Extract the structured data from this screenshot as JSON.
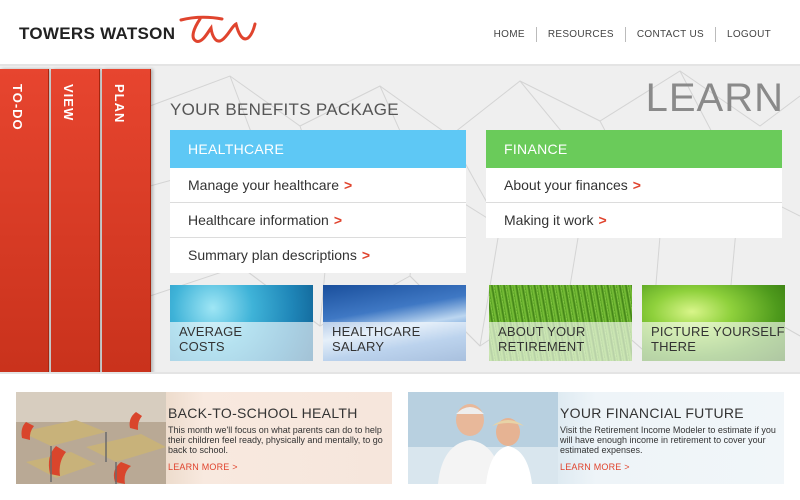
{
  "header": {
    "logo_text": "TOWERS WATSON",
    "nav": [
      {
        "label": "HOME"
      },
      {
        "label": "RESOURCES"
      },
      {
        "label": "CONTACT US"
      },
      {
        "label": "LOGOUT"
      }
    ]
  },
  "side_tabs": [
    {
      "label": "TO-DO"
    },
    {
      "label": "VIEW"
    },
    {
      "label": "PLAN"
    }
  ],
  "main": {
    "section_title": "LEARN",
    "package_title": "YOUR BENEFITS PACKAGE",
    "healthcare": {
      "title": "HEALTHCARE",
      "links": [
        "Manage your healthcare",
        "Healthcare information",
        "Summary plan descriptions"
      ]
    },
    "finance": {
      "title": "FINANCE",
      "links": [
        "About your finances",
        "Making it work"
      ]
    },
    "tiles": [
      {
        "line1": "AVERAGE",
        "line2": "COSTS"
      },
      {
        "line1": "HEALTHCARE",
        "line2": "SALARY"
      },
      {
        "line1": "ABOUT YOUR",
        "line2": "RETIREMENT"
      },
      {
        "line1": "PICTURE YOURSELF",
        "line2": "THERE"
      }
    ]
  },
  "promos": [
    {
      "title": "BACK-TO-SCHOOL HEALTH",
      "body": "This month we'll focus on what parents can do to help their children feel ready, physically and mentally, to go back to school.",
      "more": "LEARN MORE"
    },
    {
      "title": "YOUR FINANCIAL FUTURE",
      "body": "Visit the Retirement Income Modeler to estimate if you will have enough income in retirement to cover your estimated expenses.",
      "more": "LEARN MORE"
    }
  ],
  "colors": {
    "brand_red": "#e0442e",
    "healthcare_blue": "#5ec8f5",
    "finance_green": "#6acb5a"
  }
}
